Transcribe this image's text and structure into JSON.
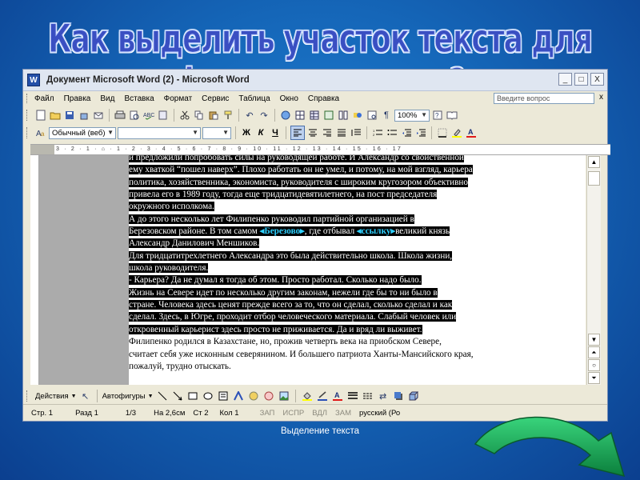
{
  "slide": {
    "title": "Как выделить участок текста для форматирования?",
    "caption": "Выделение текста"
  },
  "window": {
    "title": "Документ Microsoft Word (2) - Microsoft Word",
    "app_icon_letter": "W",
    "buttons": [
      "_",
      "□",
      "X"
    ]
  },
  "menu": {
    "items": [
      "Файл",
      "Правка",
      "Вид",
      "Вставка",
      "Формат",
      "Сервис",
      "Таблица",
      "Окно",
      "Справка"
    ],
    "help_placeholder": "Введите вопрос",
    "help_close": "x"
  },
  "standard_toolbar": {
    "zoom": "100%"
  },
  "format_toolbar": {
    "style": "Обычный (веб)",
    "bold": "Ж",
    "italic": "К",
    "underline": "Ч"
  },
  "ruler": {
    "marks": "3 · 2 · 1 · ⌂ · 1 · 2 · 3 · 4 · 5 · 6 · 7 · 8 · 9 · 10 · 11 · 12 · 13 · 14 · 15 · 16 · 17"
  },
  "document": {
    "lines": [
      {
        "text": "и предложили попробовать силы на руководящей работе. И Александр со свойственной",
        "hl": true
      },
      {
        "text": "ему хваткой “пошел наверх”. Плохо работать он не умел, и потому, на мой взгляд, карьера",
        "hl": true
      },
      {
        "text": "политика, хозяйственника, экономиста, руководителя с широким кругозором объективно",
        "hl": true
      },
      {
        "text": "привела его в 1989 году, тогда еще тридцатидевятилетнего, на пост председателя",
        "hl": true
      },
      {
        "text": "окружного исполкома.",
        "hl": true
      },
      {
        "text": "      А до этого несколько лет Филипенко руководил партийной организацией в",
        "hl": true
      },
      {
        "text": "Березовском районе. В том самом ",
        "hl": true,
        "link1": "Березово",
        "mid": ", где отбывал ",
        "link2": "ссылку",
        "tail": "великий князь"
      },
      {
        "text": "Александр Данилович Меншиков.",
        "hl": true
      },
      {
        "text": "      Для тридцатитрехлетнего Александра это была действительно школа. Школа жизни,",
        "hl": true
      },
      {
        "text": "школа руководителя.",
        "hl": true
      },
      {
        "text": "      - Карьера? Да не думал я тогда об этом. Просто работал. Сколько надо было.",
        "hl": true
      },
      {
        "text": "      Жизнь на Севере идет по несколько другим законам, нежели где бы то ни было в",
        "hl": true
      },
      {
        "text": "стране. Человека здесь ценят прежде всего за то, что он сделал, сколько сделал и как",
        "hl": true
      },
      {
        "text": "сделал. Здесь, в Югре, проходит отбор человеческого материала. Слабый человек или",
        "hl": true
      },
      {
        "text": "откровенный карьерист здесь просто не приживается. Да и вряд ли выживет.",
        "hl": true
      },
      {
        "text": "      Филипенко родился в Казахстане, но, прожив четверть века на приобском Севере,",
        "hl": false
      },
      {
        "text": "считает себя уже исконным северянином. И большего патриота Ханты-Мансийского края,",
        "hl": false
      },
      {
        "text": "пожалуй, трудно отыскать.",
        "hl": false
      }
    ]
  },
  "drawing_toolbar": {
    "actions": "Действия",
    "autoshapes": "Автофигуры"
  },
  "status": {
    "page": "Стр. 1",
    "section": "Разд 1",
    "pages": "1/3",
    "at": "На 2,6см",
    "line": "Ст 2",
    "col": "Кол 1",
    "rec": "ЗАП",
    "trk": "ИСПР",
    "ext": "ВДЛ",
    "ovr": "ЗАМ",
    "lang": "русский (Ро"
  },
  "colors": {
    "background": "#1566b8",
    "title_fill": "#3a4fc2",
    "selection": "#000000",
    "link_text": "#2ed0ff",
    "arrow": "#12a85a"
  }
}
